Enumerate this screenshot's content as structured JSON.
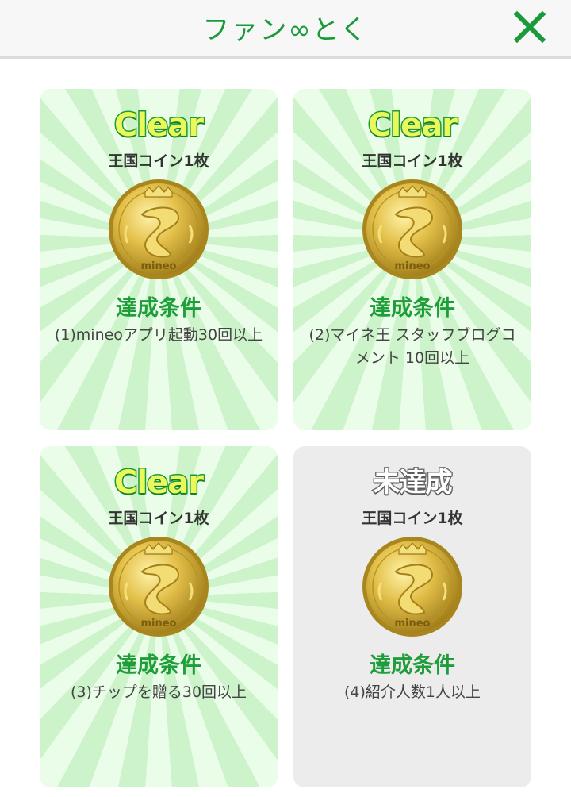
{
  "header": {
    "title": "ファン∞とく",
    "close_icon": "close-icon"
  },
  "colors": {
    "accent_green": "#1b9a3c",
    "clear_card_bg": "#d5f6d3",
    "pending_card_bg": "#ececec"
  },
  "cards": [
    {
      "status": "Clear",
      "reward": "王国コイン1枚",
      "coin_brand": "mineo",
      "condition_title": "達成条件",
      "condition": "(1)mineoアプリ起動30回以上"
    },
    {
      "status": "Clear",
      "reward": "王国コイン1枚",
      "coin_brand": "mineo",
      "condition_title": "達成条件",
      "condition": "(2)マイネ王 スタッフブログコメント 10回以上"
    },
    {
      "status": "Clear",
      "reward": "王国コイン1枚",
      "coin_brand": "mineo",
      "condition_title": "達成条件",
      "condition": "(3)チップを贈る30回以上"
    },
    {
      "status": "未達成",
      "reward": "王国コイン1枚",
      "coin_brand": "mineo",
      "condition_title": "達成条件",
      "condition": "(4)紹介人数1人以上"
    }
  ]
}
